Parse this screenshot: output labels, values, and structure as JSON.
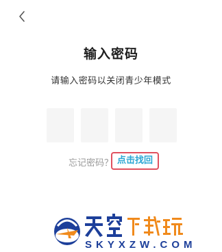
{
  "icons": {
    "back": "chevron-left-icon"
  },
  "header": {
    "title": "输入密码",
    "subtitle": "请输入密码以关闭青少年模式"
  },
  "pin": {
    "slots": 4,
    "entered": 0
  },
  "forgot": {
    "label": "忘记密码？",
    "link": "点击找回"
  },
  "watermark": {
    "brand_cn": "天空",
    "tagline": "下载玩",
    "domain": "SKYXZW.COM"
  },
  "colors": {
    "link": "#2aa6d3",
    "highlight_border": "#e0505e",
    "pin_box": "#f5f5f5",
    "watermark_blue": "#1d3f9a",
    "watermark_orange": "#f08a1c"
  }
}
